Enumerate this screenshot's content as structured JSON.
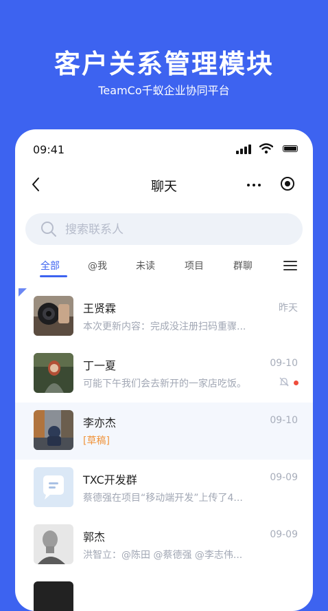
{
  "hero": {
    "title": "客户关系管理模块",
    "subtitle": "TeamCo千蚁企业协同平台"
  },
  "status_bar": {
    "time": "09:41"
  },
  "navbar": {
    "title": "聊天"
  },
  "search": {
    "placeholder": "搜索联系人",
    "value": ""
  },
  "tabs": [
    {
      "label": "全部",
      "active": true
    },
    {
      "label": "@我"
    },
    {
      "label": "未读"
    },
    {
      "label": "项目"
    },
    {
      "label": "群聊"
    }
  ],
  "chats": [
    {
      "name": "王贤霖",
      "time": "昨天",
      "preview": "本次更新内容：完成没注册扫码重骤...",
      "avatar": "photo-camera"
    },
    {
      "name": "丁一夏",
      "time": "09-10",
      "preview": "可能下午我们会去新开的一家店吃饭。",
      "muted": true,
      "unread_dot": true,
      "avatar": "photo-woman"
    },
    {
      "name": "李亦杰",
      "time": "09-10",
      "preview": "[草稿]",
      "draft": true,
      "highlighted": true,
      "avatar": "photo-street"
    },
    {
      "name": "TXC开发群",
      "time": "09-09",
      "preview": "蔡德强在项目“移动端开发”上传了4...",
      "avatar": "group-chat-icon"
    },
    {
      "name": "郭杰",
      "time": "09-09",
      "preview": "洪智立：@陈田  @蔡德强 @李志伟...",
      "avatar": "photo-man"
    }
  ],
  "colors": {
    "brand": "#3d63f0",
    "draft": "#f0933a",
    "unread_dot": "#ef4d3c",
    "highlight_row": "#f4f7fd"
  }
}
